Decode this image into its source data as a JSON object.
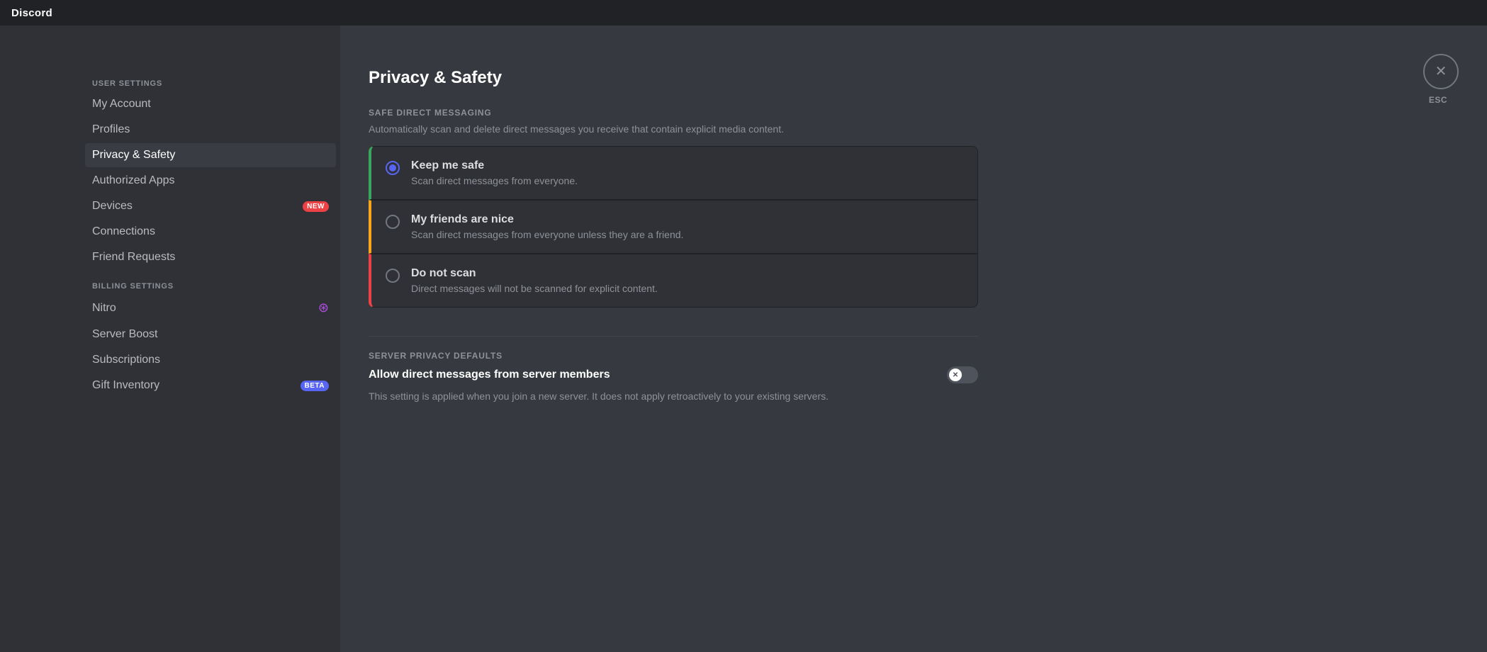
{
  "titlebar": {
    "logo": "Discord"
  },
  "sidebar": {
    "user_settings_label": "User Settings",
    "billing_settings_label": "Billing Settings",
    "items": [
      {
        "id": "my-account",
        "label": "My Account",
        "active": false,
        "badge": null
      },
      {
        "id": "profiles",
        "label": "Profiles",
        "active": false,
        "badge": null
      },
      {
        "id": "privacy-safety",
        "label": "Privacy & Safety",
        "active": true,
        "badge": null
      },
      {
        "id": "authorized-apps",
        "label": "Authorized Apps",
        "active": false,
        "badge": null
      },
      {
        "id": "devices",
        "label": "Devices",
        "active": false,
        "badge": "NEW"
      },
      {
        "id": "connections",
        "label": "Connections",
        "active": false,
        "badge": null
      },
      {
        "id": "friend-requests",
        "label": "Friend Requests",
        "active": false,
        "badge": null
      }
    ],
    "billing_items": [
      {
        "id": "nitro",
        "label": "Nitro",
        "active": false,
        "badge": null,
        "special_icon": "nitro"
      },
      {
        "id": "server-boost",
        "label": "Server Boost",
        "active": false,
        "badge": null
      },
      {
        "id": "subscriptions",
        "label": "Subscriptions",
        "active": false,
        "badge": null
      },
      {
        "id": "gift-inventory",
        "label": "Gift Inventory",
        "active": false,
        "badge": "BETA"
      }
    ]
  },
  "main": {
    "page_title": "Privacy & Safety",
    "safe_dm_section": {
      "label": "Safe Direct Messaging",
      "description": "Automatically scan and delete direct messages you receive that contain explicit media content.",
      "options": [
        {
          "id": "keep-safe",
          "title": "Keep me safe",
          "subtitle": "Scan direct messages from everyone.",
          "checked": true,
          "border_color": "#3ba55d"
        },
        {
          "id": "friends-nice",
          "title": "My friends are nice",
          "subtitle": "Scan direct messages from everyone unless they are a friend.",
          "checked": false,
          "border_color": "#faa61a"
        },
        {
          "id": "no-scan",
          "title": "Do not scan",
          "subtitle": "Direct messages will not be scanned for explicit content.",
          "checked": false,
          "border_color": "#ed4245"
        }
      ]
    },
    "server_privacy_section": {
      "label": "Server Privacy Defaults",
      "setting_name": "Allow direct messages from server members",
      "setting_note": "This setting is applied when you join a new server. It does not apply retroactively to your existing servers.",
      "toggle_enabled": false
    },
    "close_btn": {
      "esc_label": "ESC"
    }
  }
}
